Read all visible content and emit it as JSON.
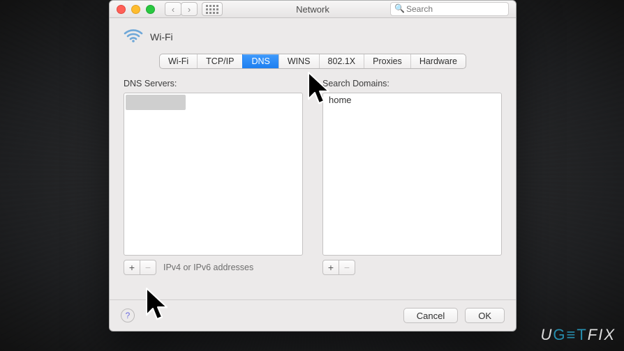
{
  "window": {
    "title": "Network",
    "search_placeholder": "Search"
  },
  "header": {
    "label": "Wi-Fi"
  },
  "tabs": [
    "Wi-Fi",
    "TCP/IP",
    "DNS",
    "WINS",
    "802.1X",
    "Proxies",
    "Hardware"
  ],
  "active_tab": "DNS",
  "left_panel": {
    "title": "DNS Servers:",
    "hint": "IPv4 or IPv6 addresses"
  },
  "right_panel": {
    "title": "Search Domains:",
    "items": [
      "home"
    ]
  },
  "buttons": {
    "cancel": "Cancel",
    "ok": "OK"
  },
  "watermark": {
    "pre": "U",
    "mid": "G≡T",
    "post": "FIX"
  }
}
